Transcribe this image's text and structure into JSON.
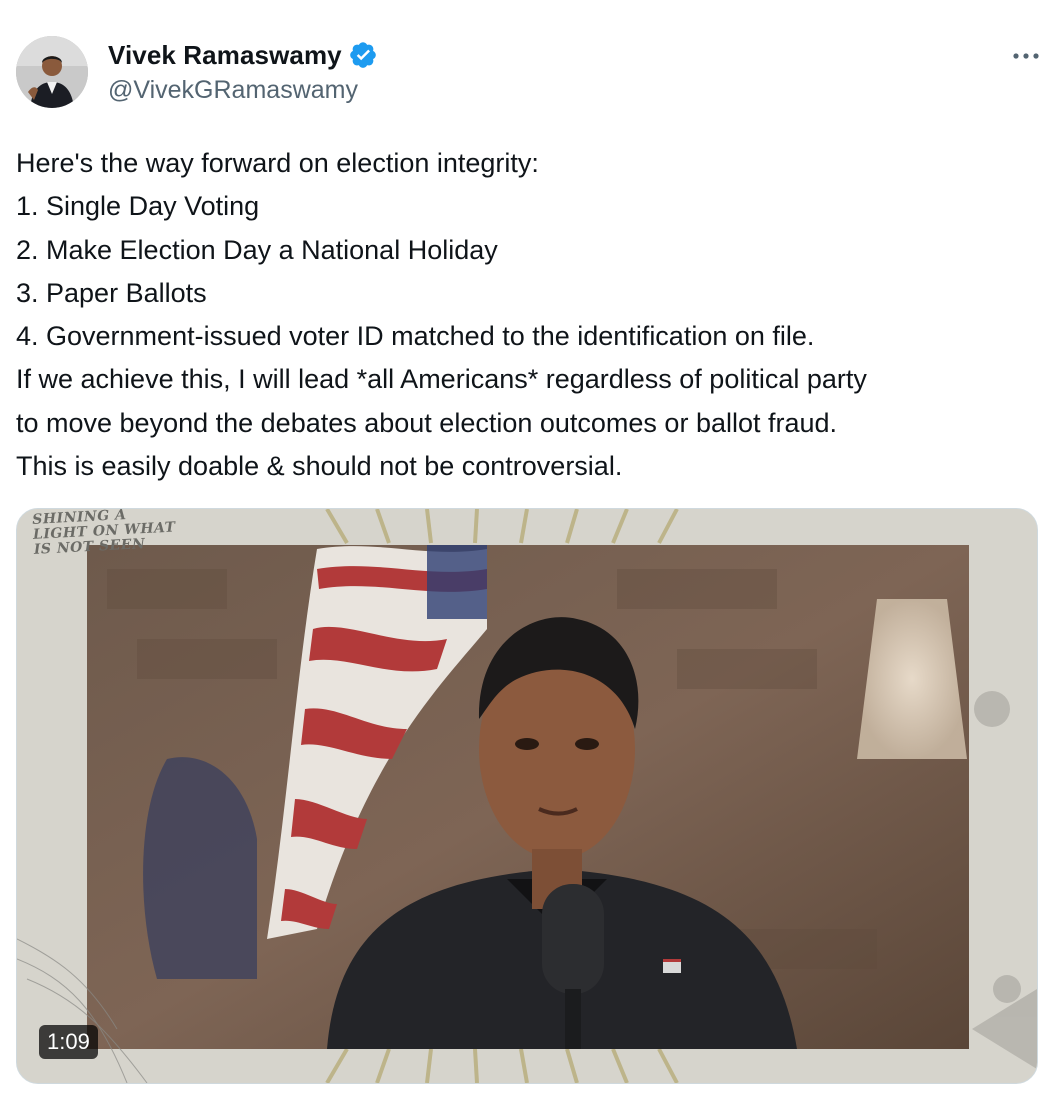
{
  "author": {
    "display_name": "Vivek Ramaswamy",
    "handle": "@VivekGRamaswamy",
    "verified": true,
    "verified_color": "#1d9bf0"
  },
  "tweet": {
    "lines": [
      "Here's the way forward on election integrity:",
      "1. Single Day Voting",
      "2. Make Election Day a National Holiday",
      "3. Paper Ballots",
      "4. Government-issued voter ID matched to the identification on file.",
      "If we achieve this, I will lead *all Americans* regardless of political party",
      "to move beyond the debates about election outcomes or ballot fraud.",
      "This is easily doable & should not be controversial."
    ]
  },
  "media": {
    "type": "video",
    "duration": "1:09",
    "overlay_stamp": "SHINING A LIGHT ON WHAT IS NOT SEEN",
    "icons": {
      "more": "more-horizontal-icon",
      "verified": "verified-badge-icon"
    }
  },
  "colors": {
    "text_primary": "#0f1419",
    "text_secondary": "#536471",
    "accent": "#1d9bf0"
  }
}
